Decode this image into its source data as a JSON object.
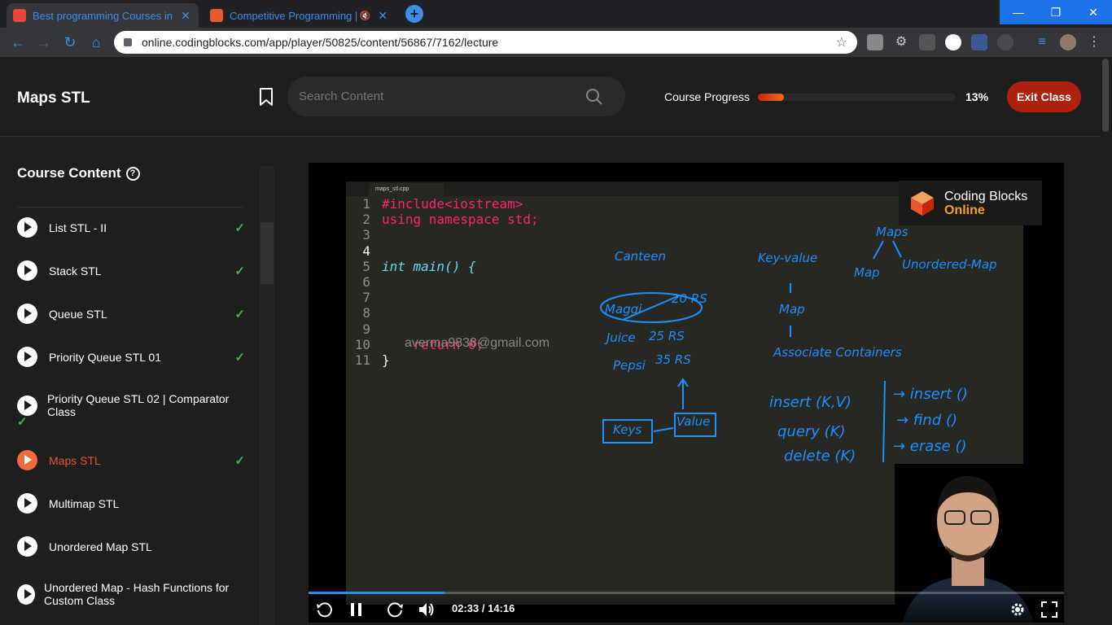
{
  "browser": {
    "tabs": [
      {
        "title": "Best programming Courses in De",
        "active": true
      },
      {
        "title": "Competitive Programming |",
        "active": false
      }
    ],
    "new_tab": "+",
    "url": "online.codingblocks.com/app/player/50825/content/56867/7162/lecture",
    "window_buttons": [
      "—",
      "❐",
      "✕"
    ]
  },
  "header": {
    "title": "Maps STL",
    "search_placeholder": "Search Content",
    "progress_label": "Course Progress",
    "progress_percent": "13%",
    "progress_fraction": 0.13,
    "exit_label": "Exit Class"
  },
  "sidebar": {
    "title": "Course Content",
    "items": [
      {
        "label": "List STL - II",
        "done": true,
        "current": false
      },
      {
        "label": "Stack STL",
        "done": true,
        "current": false
      },
      {
        "label": "Queue STL",
        "done": true,
        "current": false
      },
      {
        "label": "Priority Queue STL 01",
        "done": true,
        "current": false
      },
      {
        "label": "Priority Queue STL 02 | Comparator Class",
        "done": true,
        "current": false
      },
      {
        "label": "Maps STL",
        "done": true,
        "current": true
      },
      {
        "label": "Multimap STL",
        "done": false,
        "current": false
      },
      {
        "label": "Unordered Map STL",
        "done": false,
        "current": false
      },
      {
        "label": "Unordered Map - Hash Functions for Custom Class",
        "done": false,
        "current": false
      }
    ]
  },
  "player": {
    "editor_tab": "maps_stl.cpp",
    "code_lines": [
      {
        "n": "1",
        "text": "#include<iostream>"
      },
      {
        "n": "2",
        "text": "using namespace std;"
      },
      {
        "n": "3",
        "text": ""
      },
      {
        "n": "4",
        "text": ""
      },
      {
        "n": "5",
        "text": "int main() {"
      },
      {
        "n": "6",
        "text": ""
      },
      {
        "n": "7",
        "text": ""
      },
      {
        "n": "8",
        "text": ""
      },
      {
        "n": "9",
        "text": ""
      },
      {
        "n": "10",
        "text": "    return 0;"
      },
      {
        "n": "11",
        "text": "}"
      }
    ],
    "watermark": "averma9838@gmail.com",
    "logo_line1": "Coding Blocks",
    "logo_line2": "Online",
    "annotations": [
      "Canteen",
      "Maggi",
      "20 RS",
      "Juice",
      "25 RS",
      "Pepsi",
      "35 RS",
      "Keys",
      "Value",
      "Key-value",
      "Map",
      "Associate Containers",
      "Maps",
      "Map",
      "Unordered-Map",
      "insert (K,V)",
      "query (K)",
      "delete (K)",
      "→ insert ()",
      "→ find ()",
      "→ erase ()"
    ],
    "time_current": "02:33",
    "time_total": "14:16",
    "time_display": "02:33 / 14:16",
    "played_fraction": 0.18
  },
  "colors": {
    "accent": "#b0200e",
    "check": "#4caf50",
    "current_item": "#e85a2c",
    "ink": "#1e90ff"
  }
}
